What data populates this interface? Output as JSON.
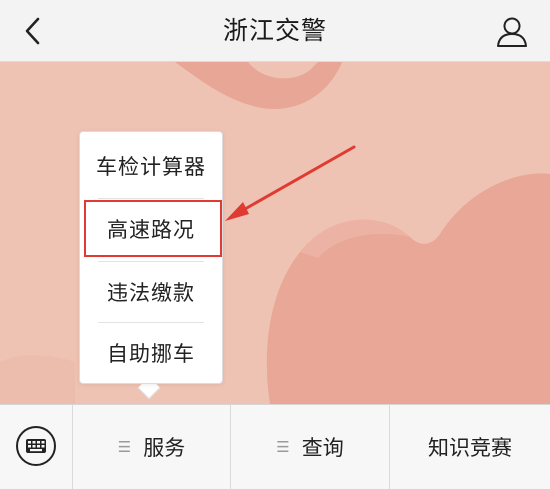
{
  "header": {
    "title": "浙江交警",
    "back_icon": "chevron-left-icon",
    "profile_icon": "user-icon"
  },
  "popup_menu": {
    "items": [
      {
        "label": "车检计算器"
      },
      {
        "label": "高速路况",
        "highlighted": true
      },
      {
        "label": "违法缴款"
      },
      {
        "label": "自助挪车"
      }
    ]
  },
  "bottom_bar": {
    "keyboard_icon": "keyboard-icon",
    "tabs": [
      {
        "label": "服务",
        "icon": "menu-lines-icon",
        "expanded": true
      },
      {
        "label": "查询",
        "icon": "menu-lines-icon"
      },
      {
        "label": "知识竞赛"
      }
    ]
  },
  "colors": {
    "background": "#efc3b3",
    "annotation_red": "#e03b32",
    "header_bg": "#f3f3f3",
    "bottom_bar_bg": "#f7f7f7"
  }
}
